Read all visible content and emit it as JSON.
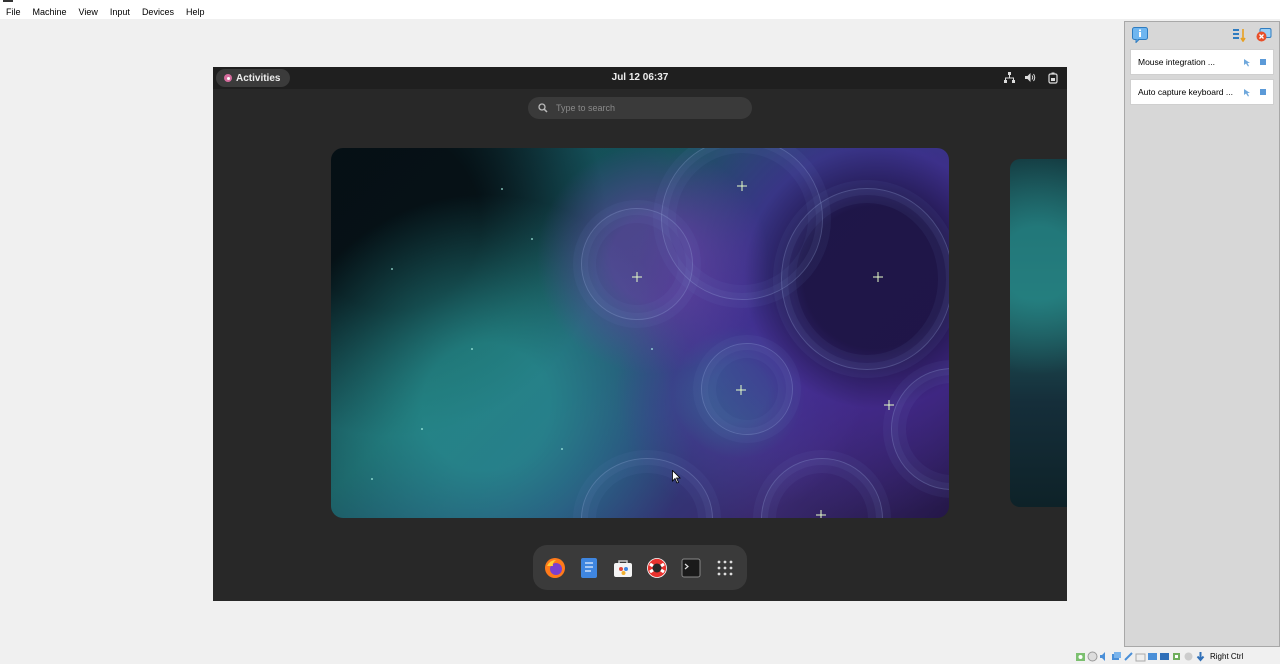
{
  "menubar": {
    "items": [
      "File",
      "Machine",
      "View",
      "Input",
      "Devices",
      "Help"
    ]
  },
  "guest": {
    "activities_label": "Activities",
    "clock": "Jul 12  06:37",
    "search_placeholder": "Type to search",
    "tray_icons": [
      "network-icon",
      "volume-icon",
      "power-icon"
    ],
    "dock_apps": [
      {
        "name": "firefox",
        "icon": "firefox-icon"
      },
      {
        "name": "text-editor",
        "icon": "text-editor-icon"
      },
      {
        "name": "software",
        "icon": "software-icon"
      },
      {
        "name": "help",
        "icon": "help-icon"
      },
      {
        "name": "terminal",
        "icon": "terminal-icon"
      },
      {
        "name": "show-apps",
        "icon": "app-grid-icon"
      }
    ]
  },
  "notifications": {
    "items": [
      {
        "text": "Mouse integration ..."
      },
      {
        "text": "Auto capture keyboard ..."
      }
    ]
  },
  "statusbar": {
    "host_key": "Right Ctrl"
  },
  "colors": {
    "guest_bg": "#282828",
    "guest_topbar": "#1f1f1f",
    "panel_bg": "#d7d7d7",
    "host_bg": "#f0f0f0"
  }
}
